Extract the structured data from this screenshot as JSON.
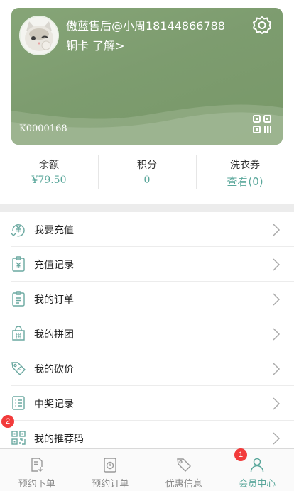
{
  "profile": {
    "username": "傲蓝售后@小周18144866788",
    "level": "铜卡 了解>",
    "card_number": "K0000168",
    "icons": {
      "settings": "gear-icon",
      "qr": "qr-code-icon",
      "avatar": "cat-avatar"
    }
  },
  "stats": {
    "balance": {
      "label": "余额",
      "value": "¥79.50"
    },
    "points": {
      "label": "积分",
      "value": "0"
    },
    "vouchers": {
      "label": "洗衣券",
      "value": "查看(0)"
    }
  },
  "menu": {
    "items": [
      {
        "label": "我要充值",
        "icon": "recharge-icon"
      },
      {
        "label": "充值记录",
        "icon": "recharge-record-icon"
      },
      {
        "label": "我的订单",
        "icon": "orders-icon"
      },
      {
        "label": "我的拼团",
        "icon": "group-buy-icon"
      },
      {
        "label": "我的砍价",
        "icon": "bargain-tag-icon"
      },
      {
        "label": "中奖记录",
        "icon": "list-icon"
      },
      {
        "label": "我的推荐码",
        "icon": "qr-code-icon"
      }
    ]
  },
  "badges": {
    "referral": "2",
    "member": "1"
  },
  "tabbar": {
    "tabs": [
      {
        "label": "预约下单",
        "icon": "booking-icon"
      },
      {
        "label": "预约订单",
        "icon": "clock-order-icon"
      },
      {
        "label": "优惠信息",
        "icon": "coupon-tag-icon"
      },
      {
        "label": "会员中心",
        "icon": "user-icon"
      }
    ],
    "active_index": 3
  },
  "colors": {
    "accent": "#5aa79b",
    "card": "#7d9c6f",
    "badge": "#f23b3b",
    "icon": "#6aa8a0"
  }
}
